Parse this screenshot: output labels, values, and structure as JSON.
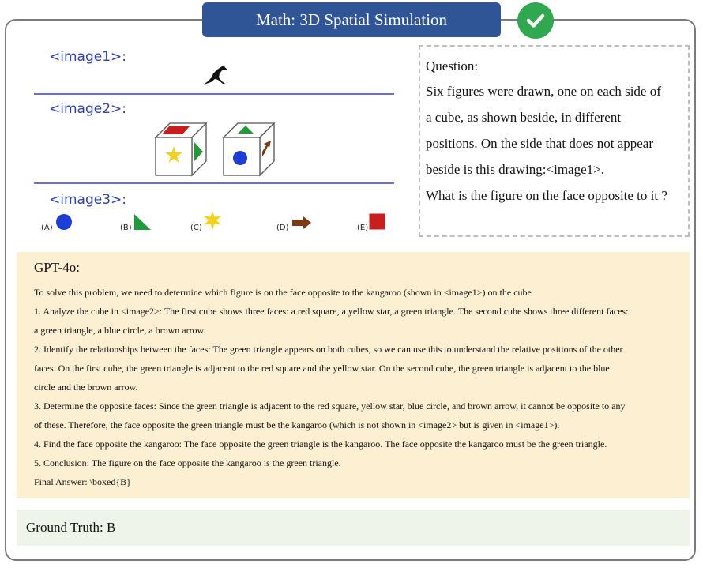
{
  "header": {
    "title": "Math:  3D Spatial Simulation",
    "status_icon": "check-circle-icon",
    "status_color": "#2fa84f"
  },
  "images": {
    "image1_label": "<image1>:",
    "image2_label": "<image2>:",
    "image3_label": "<image3>:",
    "options": [
      {
        "letter": "(A)",
        "shape": "blue circle"
      },
      {
        "letter": "(B)",
        "shape": "green triangle"
      },
      {
        "letter": "(C)",
        "shape": "yellow star"
      },
      {
        "letter": "(D)",
        "shape": "brown arrow"
      },
      {
        "letter": "(E)",
        "shape": "red square"
      }
    ]
  },
  "question": {
    "title": "Question:",
    "lines": [
      "Six figures were drawn, one on each side of",
      "a cube, as shown beside, in different",
      "positions. On the side that does not appear",
      "beside is this drawing:<image1>.",
      "What is the figure on the face opposite to it ?"
    ]
  },
  "gpt": {
    "title": "GPT-4o:",
    "lines": [
      "To solve this problem, we need to determine which figure is on the face opposite to the kangaroo (shown in <image1>) on the cube",
      "1. Analyze the cube in <image2>: The first cube shows three faces: a red square, a yellow star, a green triangle. The second cube shows three different faces:",
      "a green triangle, a blue circle, a brown arrow.",
      "2. Identify the relationships between the faces: The green triangle appears on both cubes, so we can use this to understand the relative positions of the other",
      "faces. On the first cube, the green triangle is adjacent to the red square and the yellow star. On the second cube, the green triangle is adjacent to the blue",
      "circle and the brown arrow.",
      "3. Determine the opposite faces: Since the green triangle is adjacent to the red square, yellow star, blue circle, and brown arrow, it cannot be opposite to any",
      "of these. Therefore, the face opposite the green triangle must be the kangaroo (which is not shown in <image2> but is given in <image1>).",
      "4. Find the face opposite the kangaroo: The face opposite the green triangle is the kangaroo. The face opposite the kangaroo must be the green triangle.",
      "5. Conclusion: The figure on the face opposite the kangaroo is the green triangle.",
      "Final Answer: \\boxed{B}"
    ]
  },
  "ground_truth": {
    "text": "Ground Truth:  B"
  }
}
